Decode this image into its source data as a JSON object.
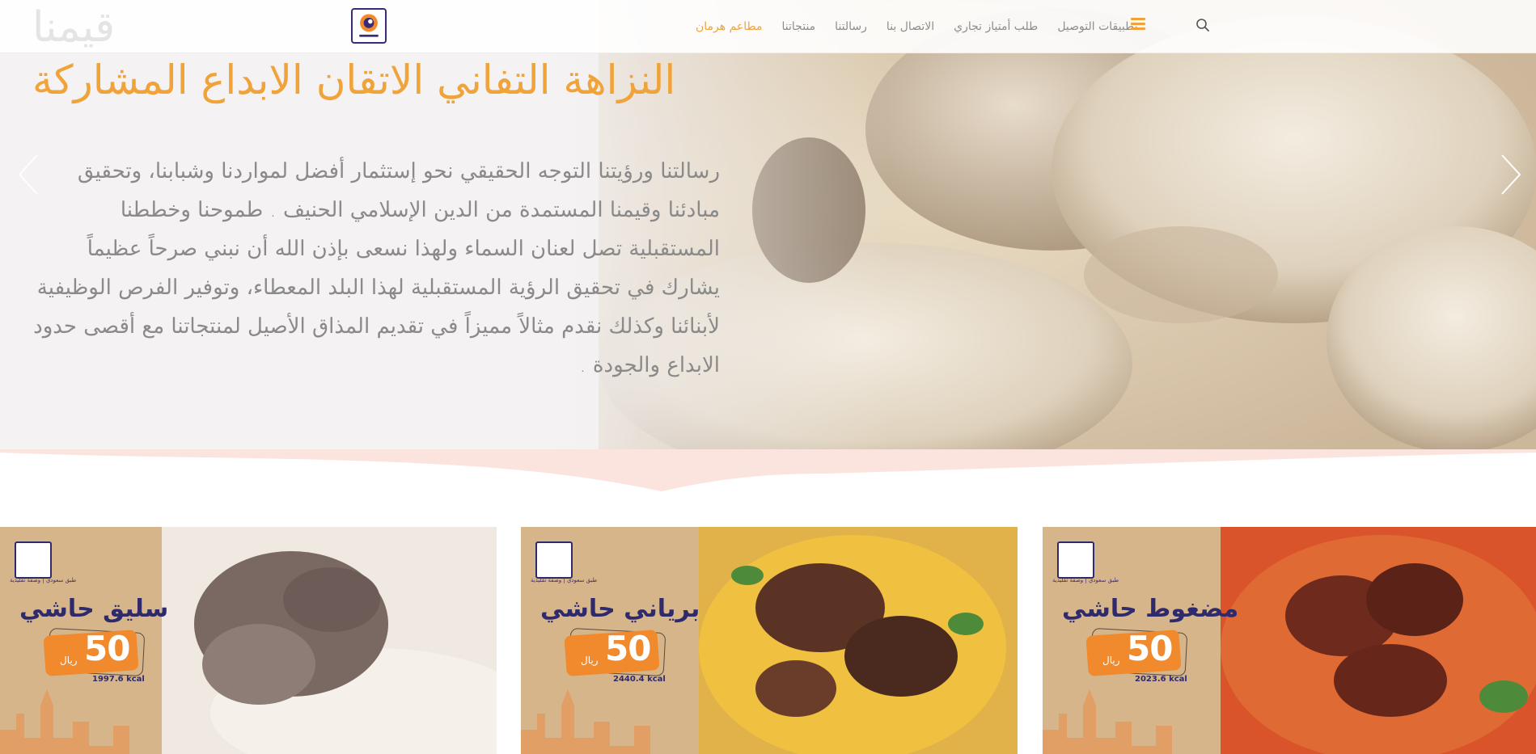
{
  "navbar": {
    "ghost_title": "قيمنا",
    "items": [
      {
        "label": "مطاعم هرمان",
        "active": true
      },
      {
        "label": "منتجاتنا",
        "active": false
      },
      {
        "label": "رسالتنا",
        "active": false
      },
      {
        "label": "الاتصال بنا",
        "active": false
      },
      {
        "label": "طلب أمتياز تجاري",
        "active": false
      },
      {
        "label": "تطبيقات التوصيل",
        "active": false
      }
    ],
    "menu_icon": "hamburger-icon",
    "search_icon": "search-icon",
    "accent_color": "#f0a339"
  },
  "hero": {
    "title": "النزاهة التفاني الاتقان الابداع المشاركة",
    "text": "رسالتنا ورؤيتنا التوجه الحقيقي نحو إستثمار أفضل لمواردنا وشبابنا، وتحقيق مبادئنا وقيمنا المستمدة من الدين الإسلامي الحنيف . طموحنا وخططنا المستقبلية تصل لعنان السماء ولهذا نسعى بإذن الله أن نبني صرحاً عظيماً يشارك في تحقيق الرؤية المستقبلية لهذا البلد المعطاء، وتوفير الفرص الوظيفية لأبنائنا وكذلك نقدم مثالاً مميزاً في تقديم المذاق الأصيل لمنتجاتنا مع أقصى حدود الابداع والجودة ."
  },
  "cards": [
    {
      "name": "سليق حاشي",
      "price": "50",
      "currency": "ريال",
      "kcal": "1997.6 kcal",
      "tag": "طبق سعودي | وصفة تقليدية",
      "dish": "white-rice-meat"
    },
    {
      "name": "برياني حاشي",
      "price": "50",
      "currency": "ريال",
      "kcal": "2440.4 kcal",
      "tag": "طبق سعودي | وصفة تقليدية",
      "dish": "yellow-biryani"
    },
    {
      "name": "مضغوط حاشي",
      "price": "50",
      "currency": "ريال",
      "kcal": "2023.6 kcal",
      "tag": "طبق سعودي | وصفة تقليدية",
      "dish": "red-rice-meat"
    }
  ]
}
